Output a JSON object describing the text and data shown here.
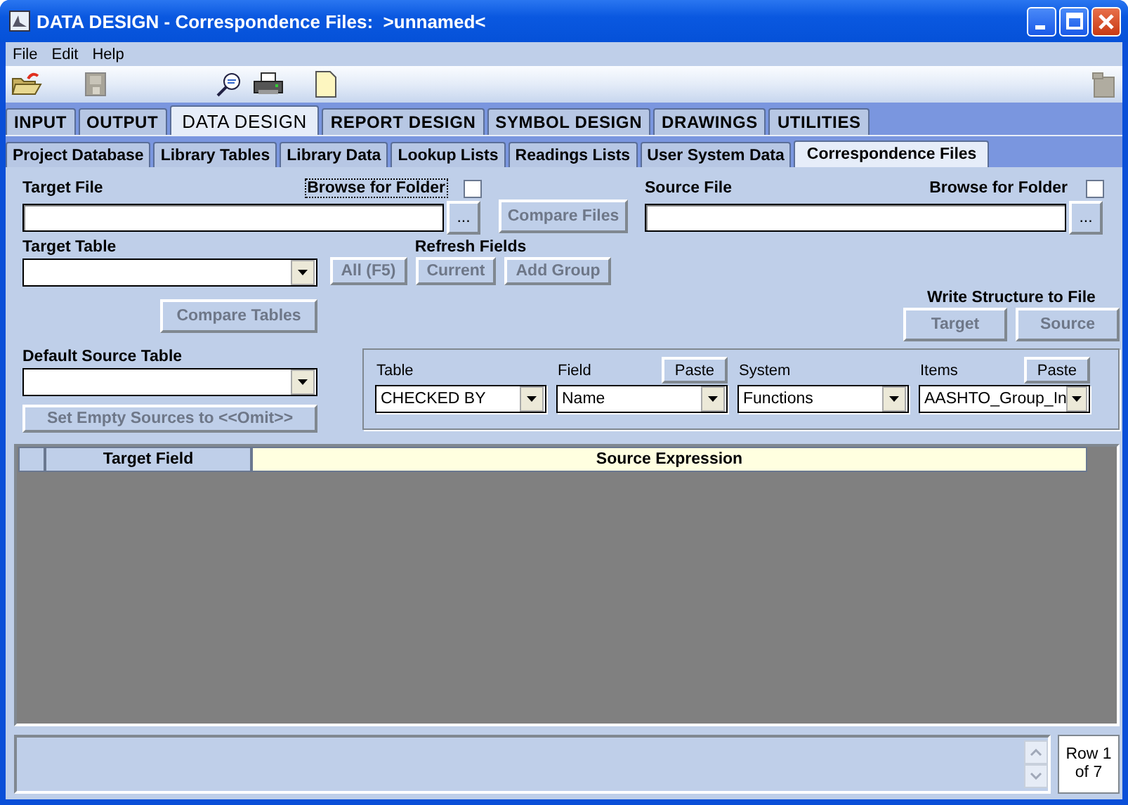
{
  "window": {
    "title": "DATA DESIGN - Correspondence Files:  >unnamed<"
  },
  "menu": [
    "File",
    "Edit",
    "Help"
  ],
  "main_tabs": [
    {
      "label": "INPUT",
      "selected": false
    },
    {
      "label": "OUTPUT",
      "selected": false
    },
    {
      "label": "DATA DESIGN",
      "selected": true
    },
    {
      "label": "REPORT DESIGN",
      "selected": false
    },
    {
      "label": "SYMBOL DESIGN",
      "selected": false
    },
    {
      "label": "DRAWINGS",
      "selected": false
    },
    {
      "label": "UTILITIES",
      "selected": false
    }
  ],
  "sub_tabs": [
    {
      "label": "Project Database",
      "selected": false
    },
    {
      "label": "Library Tables",
      "selected": false
    },
    {
      "label": "Library Data",
      "selected": false
    },
    {
      "label": "Lookup Lists",
      "selected": false
    },
    {
      "label": "Readings Lists",
      "selected": false
    },
    {
      "label": "User System Data",
      "selected": false
    },
    {
      "label": "Correspondence Files",
      "selected": true
    }
  ],
  "target_file": {
    "label": "Target File",
    "browse_label": "Browse for Folder",
    "browse_focused": true,
    "browse_checked": false,
    "browse_button": "..."
  },
  "compare_files_button": {
    "label": "Compare Files",
    "disabled": true
  },
  "source_file": {
    "label": "Source File",
    "browse_label": "Browse for Folder",
    "browse_focused": false,
    "browse_checked": false,
    "browse_button": "..."
  },
  "target_table": {
    "label": "Target Table"
  },
  "refresh_fields": {
    "label": "Refresh Fields",
    "buttons": [
      {
        "label": "All (F5)",
        "disabled": true
      },
      {
        "label": "Current",
        "disabled": true
      },
      {
        "label": "Add Group",
        "disabled": true
      }
    ]
  },
  "compare_tables_button": {
    "label": "Compare Tables",
    "disabled": true
  },
  "write_structure": {
    "label": "Write Structure to File",
    "buttons": [
      {
        "label": "Target",
        "disabled": true
      },
      {
        "label": "Source",
        "disabled": true
      }
    ]
  },
  "default_source_table": {
    "label": "Default Source Table"
  },
  "set_empty_button": {
    "label": "Set Empty Sources to <<Omit>>",
    "disabled": true
  },
  "pickers": [
    {
      "label": "Table",
      "value": "CHECKED BY"
    },
    {
      "label": "Field",
      "value": "Name",
      "paste": "Paste"
    },
    {
      "label": "System",
      "value": "Functions"
    },
    {
      "label": "Items",
      "value": "AASHTO_Group_In",
      "paste": "Paste"
    }
  ],
  "grid": {
    "columns": [
      "Target Field",
      "Source Expression"
    ]
  },
  "status": {
    "row_indicator": "Row 1 of 7"
  }
}
